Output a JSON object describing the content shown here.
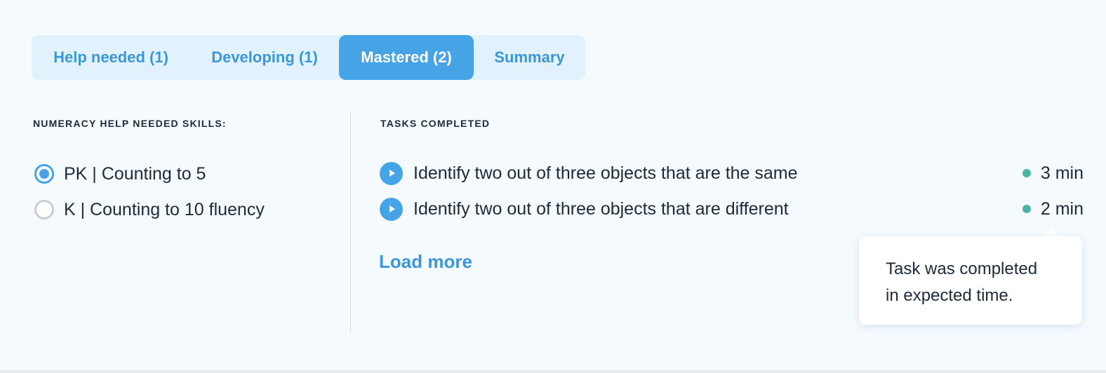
{
  "tabs": [
    {
      "label": "Help needed (1)"
    },
    {
      "label": "Developing (1)"
    },
    {
      "label": "Mastered (2)"
    },
    {
      "label": "Summary"
    }
  ],
  "active_tab": "Mastered (2)",
  "left_panel": {
    "heading": "NUMERACY HELP NEEDED SKILLS:",
    "skills": [
      {
        "label": "PK | Counting to 5",
        "checked": true
      },
      {
        "label": "K | Counting to 10 fluency",
        "checked": false
      }
    ]
  },
  "right_panel": {
    "heading": "TASKS COMPLETED",
    "tasks": [
      {
        "title": "Identify two out of three objects that are the same",
        "time": "3 min"
      },
      {
        "title": "Identify two out of three objects that are different",
        "time": "2 min"
      }
    ],
    "load_more": "Load more"
  },
  "tooltip": {
    "line1": "Task was completed",
    "line2": "in expected time."
  },
  "colors": {
    "accent": "#45a3e6",
    "status_dot": "#4db3a4",
    "tab_bar": "#e1f2fd"
  }
}
